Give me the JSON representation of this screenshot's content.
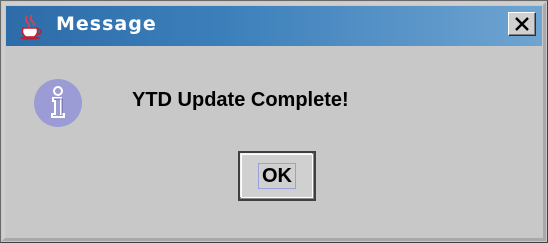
{
  "window": {
    "title": "Message",
    "title_icon": "java-coffee-cup-icon",
    "close_icon": "close-icon"
  },
  "dialog": {
    "icon": "information-icon",
    "message": "YTD Update Complete!",
    "ok_label": "OK"
  },
  "colors": {
    "titlebar_start": "#2d6ca8",
    "titlebar_end": "#6fa4d2",
    "dialog_bg": "#c8c8c8",
    "info_icon": "#9b9bd6"
  }
}
